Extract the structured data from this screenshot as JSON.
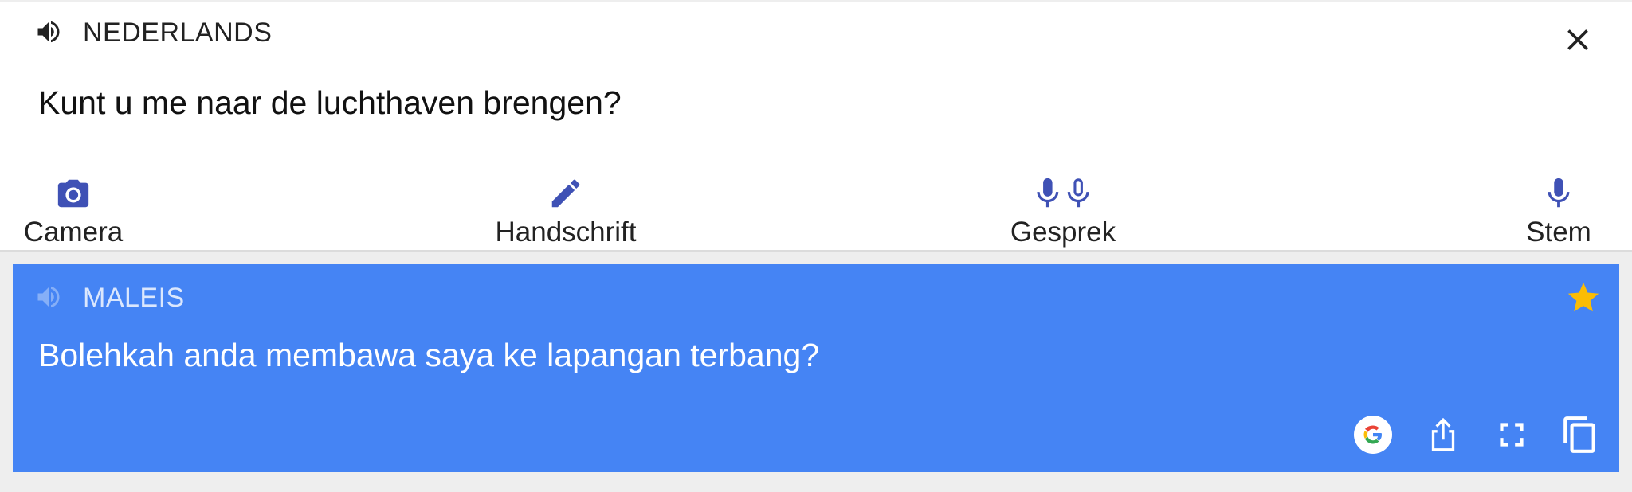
{
  "source": {
    "language": "NEDERLANDS",
    "text": "Kunt u me naar de luchthaven brengen?",
    "speaker_icon": "speaker-icon",
    "close_icon": "close-icon"
  },
  "tools": [
    {
      "label": "Camera",
      "icon": "camera-icon"
    },
    {
      "label": "Handschrift",
      "icon": "pen-icon"
    },
    {
      "label": "Gesprek",
      "icon": "dual-microphone-icon"
    },
    {
      "label": "Stem",
      "icon": "microphone-icon"
    }
  ],
  "target": {
    "language": "MALEIS",
    "text": "Bolehkah anda membawa saya ke lapangan terbang?",
    "speaker_icon": "speaker-icon",
    "star_icon": "star-icon",
    "actions": [
      "google-icon",
      "share-icon",
      "fullscreen-icon",
      "copy-icon"
    ]
  },
  "colors": {
    "accent": "#3f51b5",
    "card": "#4584f4",
    "star": "#fbbc04"
  }
}
